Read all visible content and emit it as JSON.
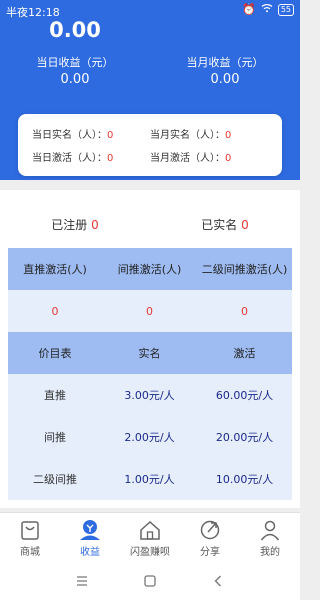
{
  "status": {
    "time": "半夜12:18",
    "battery": "55"
  },
  "header": {
    "total": "0.00",
    "daily_label": "当日收益（元）",
    "daily_value": "0.00",
    "monthly_label": "当月收益（元）",
    "monthly_value": "0.00"
  },
  "stats": [
    {
      "label": "当日实名（人）：",
      "value": "0"
    },
    {
      "label": "当月实名（人）：",
      "value": "0"
    },
    {
      "label": "当日激活（人）：",
      "value": "0"
    },
    {
      "label": "当月激活（人）：",
      "value": "0"
    }
  ],
  "summary": {
    "registered_label": "已注册 ",
    "registered_value": "0",
    "verified_label": "已实名 ",
    "verified_value": "0"
  },
  "activation_table": {
    "headers": [
      "直推激活(人)",
      "间推激活(人)",
      "二级间推激活(人)"
    ],
    "values": [
      "0",
      "0",
      "0"
    ]
  },
  "price_table": {
    "headers": [
      "价目表",
      "实名",
      "激活"
    ],
    "rows": [
      {
        "label": "直推",
        "verify": "3.00元/人",
        "activate": "60.00元/人"
      },
      {
        "label": "间推",
        "verify": "2.00元/人",
        "activate": "20.00元/人"
      },
      {
        "label": "二级间推",
        "verify": "1.00元/人",
        "activate": "10.00元/人"
      }
    ]
  },
  "tabs": [
    {
      "label": "商城",
      "icon": "shopping-bag-icon"
    },
    {
      "label": "收益",
      "icon": "earnings-icon",
      "active": true
    },
    {
      "label": "闪盈赚呗",
      "icon": "home-icon"
    },
    {
      "label": "分享",
      "icon": "share-icon"
    },
    {
      "label": "我的",
      "icon": "user-icon"
    }
  ],
  "colors": {
    "brand": "#2e6ae0",
    "accent_red": "#e53935",
    "table_head": "#9ebcf2",
    "table_cell": "#e6eefc",
    "price_value": "#1a2a8c"
  }
}
